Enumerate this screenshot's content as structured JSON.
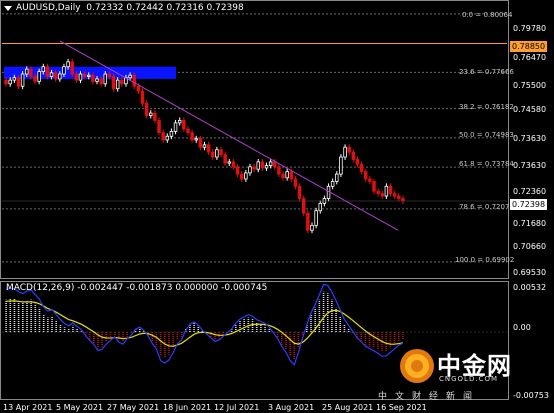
{
  "header": {
    "symbol": "AUDUSD,Daily",
    "ohlc": "0.72332 0.72442 0.72316 0.72398"
  },
  "macd_header": "MACD(12,26,9) -0.002447 -0.001873 0.000000 -0.000745",
  "price_axis": [
    "0.79780",
    "0.76470",
    "0.75500",
    "0.74580",
    "0.73630",
    "0.72360",
    "0.71680",
    "0.70660",
    "0.69530"
  ],
  "price_tags": [
    {
      "label": "0.78850",
      "bg": "#ff9d2e",
      "fg": "#000000"
    },
    {
      "label": "0.72398",
      "bg": "#ffffff",
      "fg": "#000000"
    }
  ],
  "macd_axis": [
    "0.00532",
    "0.00",
    "-0.00753"
  ],
  "fib_levels": [
    {
      "label": "0.0 = 0.80064"
    },
    {
      "label": "23.6 = 0.77666"
    },
    {
      "label": "38.2 = 0.76182"
    },
    {
      "label": "50.0 = 0.74983"
    },
    {
      "label": "61.8 = 0.73784"
    },
    {
      "label": "78.6 = 0.72077"
    },
    {
      "label": "100.0 = 0.69902"
    }
  ],
  "x_axis": [
    "13 Apr 2021",
    "5 May 2021",
    "27 May 2021",
    "18 Jun 2021",
    "12 Jul 2021",
    "3 Aug 2021",
    "25 Aug 2021",
    "16 Sep 2021"
  ],
  "watermark": {
    "brand_cn": "中金网",
    "brand_en": "CNGOLD.COM",
    "tagline": "中文财经新闻"
  },
  "colors": {
    "bull": "#ffffff",
    "bear": "#e01010",
    "resistance_line": "#ff9d2e",
    "zone": "#0a14ff",
    "trendline": "#b040d0",
    "macd_signal": "#e8e000",
    "macd_line": "#2b3cff"
  },
  "chart_data": {
    "type": "candlestick",
    "symbol": "AUDUSD",
    "timeframe": "Daily",
    "x_range": [
      "13 Apr 2021",
      "late Sep 2021"
    ],
    "ylim": [
      0.6953,
      0.8006
    ],
    "last_close": 0.72398,
    "resistance": 0.7885,
    "fibonacci": [
      {
        "level": 0.0,
        "price": 0.80064
      },
      {
        "level": 23.6,
        "price": 0.77666
      },
      {
        "level": 38.2,
        "price": 0.76182
      },
      {
        "level": 50.0,
        "price": 0.74983
      },
      {
        "level": 61.8,
        "price": 0.73784
      },
      {
        "level": 78.6,
        "price": 0.72077
      },
      {
        "level": 100.0,
        "price": 0.69902
      }
    ],
    "closes": [
      0.772,
      0.7735,
      0.7745,
      0.771,
      0.776,
      0.778,
      0.775,
      0.773,
      0.777,
      0.779,
      0.775,
      0.7765,
      0.774,
      0.776,
      0.779,
      0.781,
      0.776,
      0.7735,
      0.776,
      0.775,
      0.7755,
      0.773,
      0.774,
      0.772,
      0.776,
      0.775,
      0.77,
      0.7735,
      0.772,
      0.7745,
      0.7755,
      0.771,
      0.769,
      0.764,
      0.759,
      0.76,
      0.757,
      0.752,
      0.749,
      0.7505,
      0.7525,
      0.756,
      0.757,
      0.7535,
      0.752,
      0.749,
      0.7495,
      0.746,
      0.747,
      0.744,
      0.742,
      0.745,
      0.743,
      0.7395,
      0.74,
      0.738,
      0.735,
      0.733,
      0.7355,
      0.738,
      0.737,
      0.74,
      0.7375,
      0.7385,
      0.74,
      0.738,
      0.735,
      0.7335,
      0.736,
      0.733,
      0.73,
      0.725,
      0.719,
      0.712,
      0.714,
      0.72,
      0.723,
      0.725,
      0.73,
      0.732,
      0.735,
      0.742,
      0.746,
      0.744,
      0.741,
      0.739,
      0.736,
      0.733,
      0.732,
      0.728,
      0.727,
      0.726,
      0.73,
      0.727,
      0.726,
      0.725,
      0.724
    ],
    "macd_hist": [
      0.004,
      0.0042,
      0.0041,
      0.0038,
      0.0036,
      0.0039,
      0.004,
      0.0035,
      0.003,
      0.0022,
      0.0018,
      0.002,
      0.0015,
      0.001,
      0.0006,
      0.0004,
      0.0008,
      0.0004,
      0.0001,
      -0.0005,
      -0.001,
      -0.0014,
      -0.002,
      -0.0018,
      -0.0012,
      -0.0008,
      -0.0004,
      -0.001,
      -0.0012,
      -0.0006,
      -0.0002,
      0.0004,
      0.0006,
      0.0002,
      -0.0004,
      -0.0012,
      -0.0018,
      -0.003,
      -0.0032,
      -0.0028,
      -0.002,
      -0.001,
      -0.0006,
      0.0004,
      0.001,
      0.0012,
      0.0008,
      0.0002,
      -0.0002,
      -0.0006,
      -0.001,
      -0.0008,
      -0.0004,
      0.0,
      0.0004,
      0.001,
      0.0014,
      0.0016,
      0.0018,
      0.0016,
      0.0012,
      0.001,
      0.0008,
      0.0004,
      -0.0002,
      -0.0008,
      -0.0016,
      -0.0022,
      -0.003,
      -0.0034,
      -0.002,
      -0.0004,
      0.001,
      0.0022,
      0.003,
      0.004,
      0.005,
      0.0048,
      0.004,
      0.003,
      0.002,
      0.001,
      0.0004,
      -0.0002,
      -0.0008,
      -0.0012,
      -0.0016,
      -0.0018,
      -0.002,
      -0.0022,
      -0.0025,
      -0.0024,
      -0.002,
      -0.0016,
      -0.0012,
      -0.001
    ]
  }
}
